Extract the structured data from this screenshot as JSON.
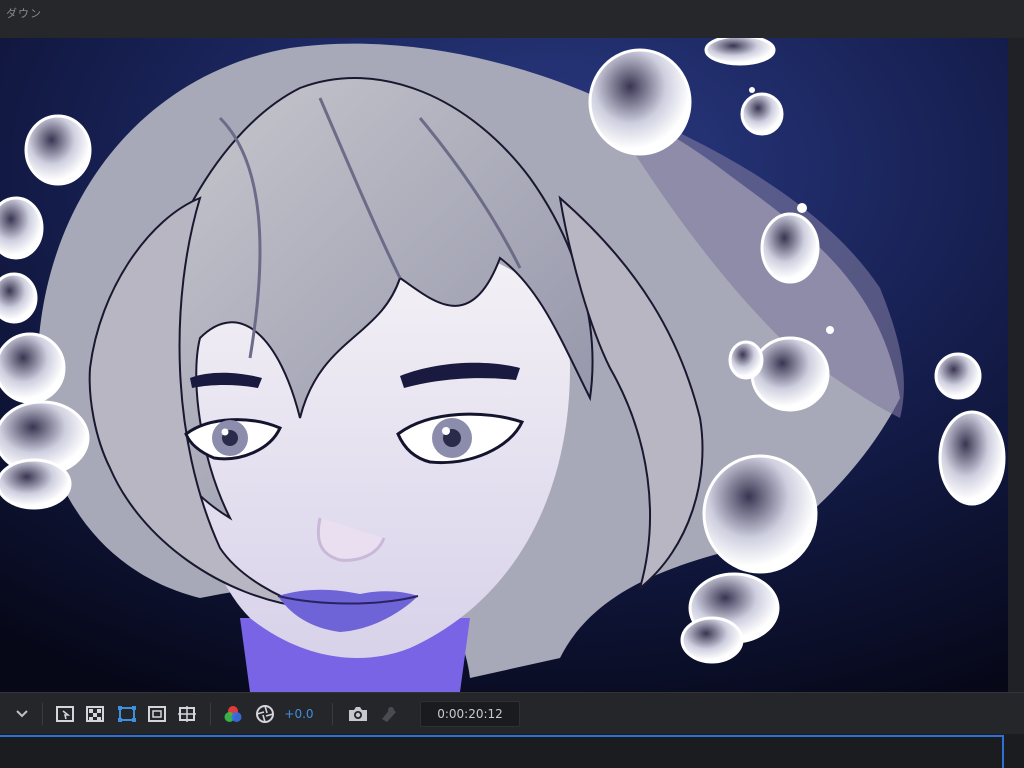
{
  "panel": {
    "title": "ダウン"
  },
  "toolbar": {
    "dropdown_icon": "chevron-down-icon",
    "icons": [
      "region-of-interest-icon",
      "transparency-grid-icon",
      "mask-path-icon",
      "safe-margins-icon",
      "grid-guides-icon",
      "color-channels-icon",
      "exposure-reset-icon",
      "snapshot-icon",
      "show-snapshot-icon"
    ],
    "exposure_value": "+0.0",
    "timecode": "0:00:20:12"
  },
  "colors": {
    "accent": "#2f6fd6",
    "exposure_text": "#3f8fe0",
    "background": "#0a0f2a"
  }
}
